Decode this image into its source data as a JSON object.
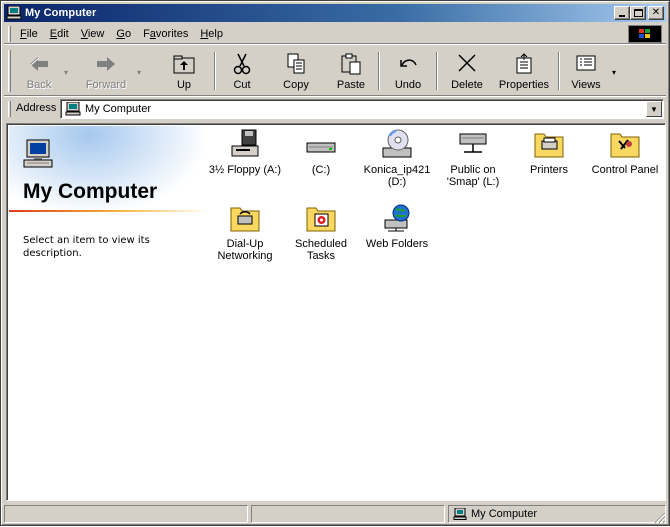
{
  "window": {
    "title": "My Computer",
    "icon": "my-computer-icon"
  },
  "menubar": {
    "items": [
      {
        "label": "File",
        "accel": "F",
        "rest": "ile"
      },
      {
        "label": "Edit",
        "accel": "E",
        "rest": "dit"
      },
      {
        "label": "View",
        "accel": "V",
        "rest": "iew"
      },
      {
        "label": "Go",
        "accel": "G",
        "rest": "o"
      },
      {
        "label": "Favorites",
        "pre": "F",
        "accel": "a",
        "rest": "vorites"
      },
      {
        "label": "Help",
        "accel": "H",
        "rest": "elp"
      }
    ]
  },
  "toolbar": {
    "buttons": [
      {
        "label": "Back",
        "icon": "back-arrow-icon",
        "enabled": false
      },
      {
        "label": "Forward",
        "icon": "forward-arrow-icon",
        "enabled": false
      },
      {
        "label": "Up",
        "icon": "folder-up-icon",
        "enabled": true
      },
      {
        "label": "Cut",
        "icon": "scissors-icon",
        "enabled": true
      },
      {
        "label": "Copy",
        "icon": "copy-icon",
        "enabled": true
      },
      {
        "label": "Paste",
        "icon": "paste-icon",
        "enabled": true
      },
      {
        "label": "Undo",
        "icon": "undo-icon",
        "enabled": true
      },
      {
        "label": "Delete",
        "icon": "delete-x-icon",
        "enabled": true
      },
      {
        "label": "Properties",
        "icon": "properties-icon",
        "enabled": true
      },
      {
        "label": "Views",
        "icon": "views-icon",
        "enabled": true
      }
    ]
  },
  "addressbar": {
    "label": "Address",
    "value": "My Computer"
  },
  "webpanel": {
    "title": "My Computer",
    "description": "Select an item to view its description."
  },
  "items": [
    {
      "label": "3½ Floppy (A:)",
      "icon": "floppy-drive-icon"
    },
    {
      "label": "(C:)",
      "icon": "hard-drive-icon"
    },
    {
      "label": "Konica_ip421 (D:)",
      "icon": "cd-drive-icon"
    },
    {
      "label": "Public on 'Smap' (L:)",
      "icon": "network-drive-icon"
    },
    {
      "label": "Printers",
      "icon": "printers-folder-icon"
    },
    {
      "label": "Control Panel",
      "icon": "control-panel-icon"
    },
    {
      "label": "Dial-Up Networking",
      "icon": "dialup-networking-icon"
    },
    {
      "label": "Scheduled Tasks",
      "icon": "scheduled-tasks-icon"
    },
    {
      "label": "Web Folders",
      "icon": "web-folders-icon"
    }
  ],
  "statusbar": {
    "zone_text": "My Computer"
  },
  "colors": {
    "titlebar_start": "#0a246a",
    "titlebar_end": "#a6caf0",
    "face": "#d4d0c8",
    "folder_yellow": "#f8d860"
  }
}
